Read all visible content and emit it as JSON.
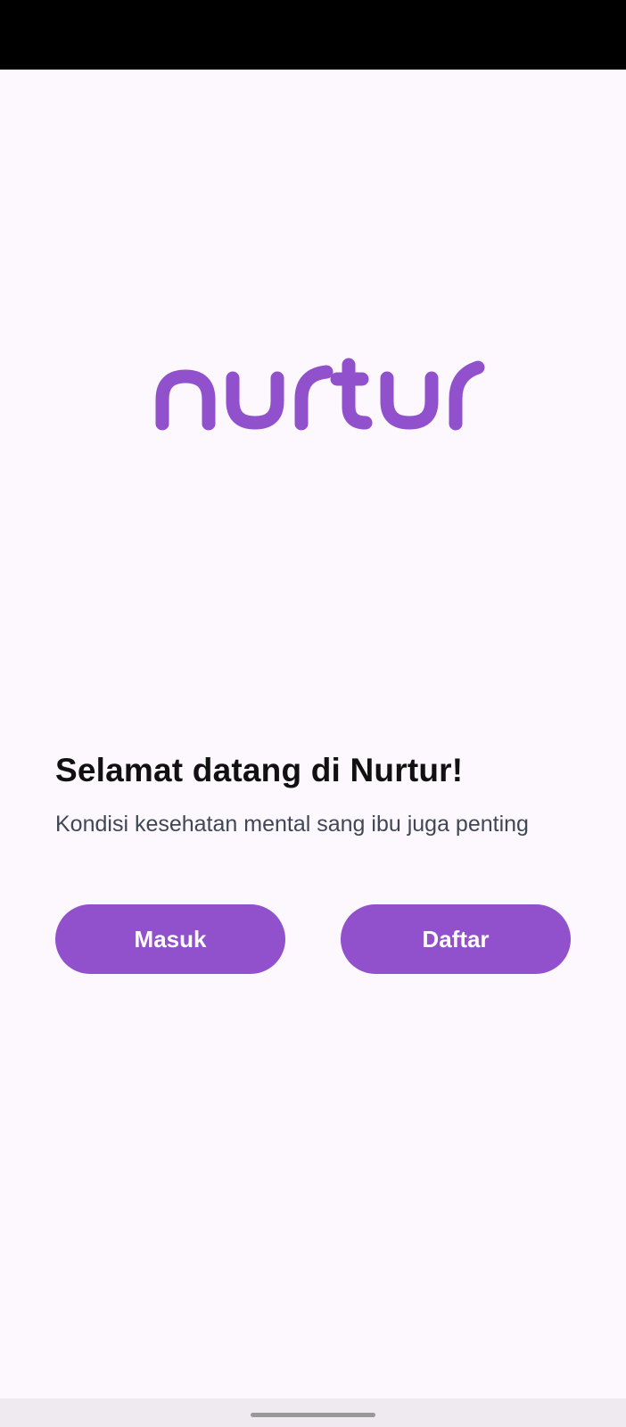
{
  "theme": {
    "accent": "#9150cc",
    "background": "#fdf8fd",
    "title_color": "#111111",
    "subtitle_color": "#3f4756"
  },
  "logo": {
    "name": "nurtur-logo",
    "text": "nurtur"
  },
  "welcome": {
    "title": "Selamat datang di Nurtur!",
    "subtitle": "Kondisi kesehatan mental sang ibu juga penting"
  },
  "actions": {
    "login_label": "Masuk",
    "register_label": "Daftar"
  }
}
